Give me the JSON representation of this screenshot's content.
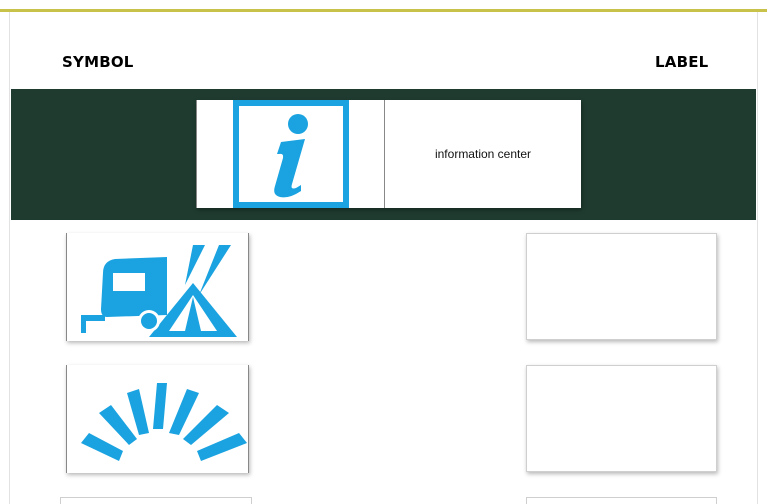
{
  "headers": {
    "symbol": "SYMBOL",
    "label": "LABEL"
  },
  "colors": {
    "band": "#1f3b30",
    "icon": "#1aa3e0",
    "top_border": "#c9c24a"
  },
  "active_pair": {
    "icon": "information-icon",
    "label": "information center"
  },
  "rows": [
    {
      "icon": "camping-caravan-tent-icon",
      "label": ""
    },
    {
      "icon": "viewpoint-icon",
      "label": ""
    }
  ]
}
